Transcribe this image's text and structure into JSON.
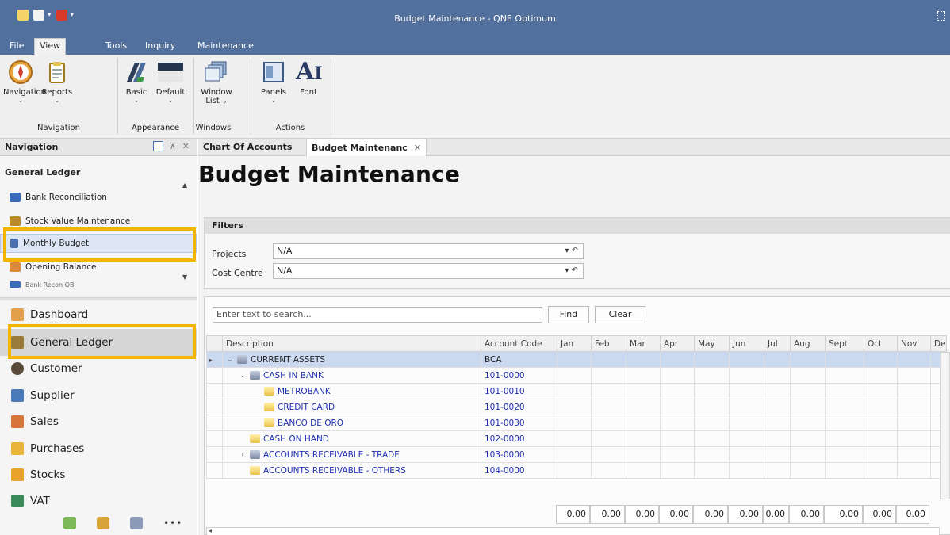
{
  "window": {
    "title": "Budget Maintenance - QNE Optimum"
  },
  "menu": {
    "tabs": [
      "File",
      "View",
      "Tools",
      "Inquiry",
      "Maintenance"
    ]
  },
  "ribbon": {
    "buttons": {
      "navigation": "Navigation",
      "reports": "Reports",
      "basic": "Basic",
      "default": "Default",
      "window_list_1": "Window",
      "window_list_2": "List",
      "panels": "Panels",
      "font": "Font"
    },
    "groups": {
      "navigation": "Navigation",
      "appearance": "Appearance",
      "windows": "Windows",
      "actions": "Actions"
    }
  },
  "nav": {
    "header": "Navigation",
    "section_title": "General Ledger",
    "items": [
      "Bank Reconciliation",
      "Stock Value Maintenance",
      "Monthly Budget",
      "Opening Balance",
      "Bank Recon OB"
    ],
    "modules": [
      "Dashboard",
      "General Ledger",
      "Customer",
      "Supplier",
      "Sales",
      "Purchases",
      "Stocks",
      "VAT"
    ]
  },
  "doc_tabs": [
    "Chart Of Accounts",
    "Budget Maintenanc"
  ],
  "page": {
    "title": "Budget Maintenance"
  },
  "filters": {
    "header": "Filters",
    "projects_label": "Projects",
    "projects_value": "N/A",
    "cost_centre_label": "Cost Centre",
    "cost_centre_value": "N/A"
  },
  "grid": {
    "search_placeholder": "Enter text to search...",
    "find_label": "Find",
    "clear_label": "Clear",
    "columns": [
      "Description",
      "Account Code",
      "Jan",
      "Feb",
      "Mar",
      "Apr",
      "May",
      "Jun",
      "Jul",
      "Aug",
      "Sept",
      "Oct",
      "Nov",
      "De"
    ],
    "rows": [
      {
        "description": "CURRENT ASSETS",
        "code": "BCA"
      },
      {
        "description": "CASH IN BANK",
        "code": "101-0000"
      },
      {
        "description": "METROBANK",
        "code": "101-0010"
      },
      {
        "description": "CREDIT CARD",
        "code": "101-0020"
      },
      {
        "description": "BANCO DE ORO",
        "code": "101-0030"
      },
      {
        "description": "CASH ON HAND",
        "code": "102-0000"
      },
      {
        "description": "ACCOUNTS RECEIVABLE - TRADE",
        "code": "103-0000"
      },
      {
        "description": "ACCOUNTS RECEIVABLE - OTHERS",
        "code": "104-0000"
      }
    ],
    "totals": [
      "0.00",
      "0.00",
      "0.00",
      "0.00",
      "0.00",
      "0.00",
      "0.00",
      "0.00",
      "0.00",
      "0.00",
      "0.00"
    ]
  },
  "colors": {
    "titlebar": "#52709e",
    "highlight": "#f5b400",
    "selected_row": "#cbd9f0",
    "link_text": "#1f2fb0"
  }
}
